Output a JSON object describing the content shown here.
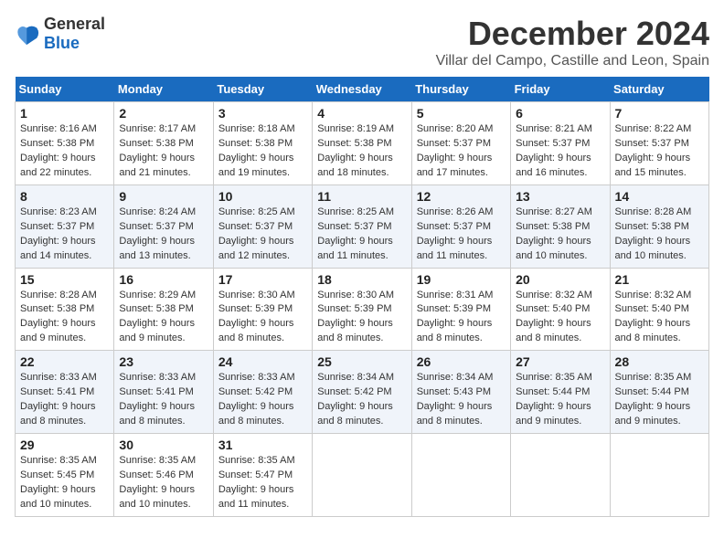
{
  "logo": {
    "text1": "General",
    "text2": "Blue"
  },
  "title": "December 2024",
  "location": "Villar del Campo, Castille and Leon, Spain",
  "days_of_week": [
    "Sunday",
    "Monday",
    "Tuesday",
    "Wednesday",
    "Thursday",
    "Friday",
    "Saturday"
  ],
  "weeks": [
    [
      {
        "day": 1,
        "sunrise": "8:16 AM",
        "sunset": "5:38 PM",
        "daylight": "9 hours and 22 minutes."
      },
      {
        "day": 2,
        "sunrise": "8:17 AM",
        "sunset": "5:38 PM",
        "daylight": "9 hours and 21 minutes."
      },
      {
        "day": 3,
        "sunrise": "8:18 AM",
        "sunset": "5:38 PM",
        "daylight": "9 hours and 19 minutes."
      },
      {
        "day": 4,
        "sunrise": "8:19 AM",
        "sunset": "5:38 PM",
        "daylight": "9 hours and 18 minutes."
      },
      {
        "day": 5,
        "sunrise": "8:20 AM",
        "sunset": "5:37 PM",
        "daylight": "9 hours and 17 minutes."
      },
      {
        "day": 6,
        "sunrise": "8:21 AM",
        "sunset": "5:37 PM",
        "daylight": "9 hours and 16 minutes."
      },
      {
        "day": 7,
        "sunrise": "8:22 AM",
        "sunset": "5:37 PM",
        "daylight": "9 hours and 15 minutes."
      }
    ],
    [
      {
        "day": 8,
        "sunrise": "8:23 AM",
        "sunset": "5:37 PM",
        "daylight": "9 hours and 14 minutes."
      },
      {
        "day": 9,
        "sunrise": "8:24 AM",
        "sunset": "5:37 PM",
        "daylight": "9 hours and 13 minutes."
      },
      {
        "day": 10,
        "sunrise": "8:25 AM",
        "sunset": "5:37 PM",
        "daylight": "9 hours and 12 minutes."
      },
      {
        "day": 11,
        "sunrise": "8:25 AM",
        "sunset": "5:37 PM",
        "daylight": "9 hours and 11 minutes."
      },
      {
        "day": 12,
        "sunrise": "8:26 AM",
        "sunset": "5:37 PM",
        "daylight": "9 hours and 11 minutes."
      },
      {
        "day": 13,
        "sunrise": "8:27 AM",
        "sunset": "5:38 PM",
        "daylight": "9 hours and 10 minutes."
      },
      {
        "day": 14,
        "sunrise": "8:28 AM",
        "sunset": "5:38 PM",
        "daylight": "9 hours and 10 minutes."
      }
    ],
    [
      {
        "day": 15,
        "sunrise": "8:28 AM",
        "sunset": "5:38 PM",
        "daylight": "9 hours and 9 minutes."
      },
      {
        "day": 16,
        "sunrise": "8:29 AM",
        "sunset": "5:38 PM",
        "daylight": "9 hours and 9 minutes."
      },
      {
        "day": 17,
        "sunrise": "8:30 AM",
        "sunset": "5:39 PM",
        "daylight": "9 hours and 8 minutes."
      },
      {
        "day": 18,
        "sunrise": "8:30 AM",
        "sunset": "5:39 PM",
        "daylight": "9 hours and 8 minutes."
      },
      {
        "day": 19,
        "sunrise": "8:31 AM",
        "sunset": "5:39 PM",
        "daylight": "9 hours and 8 minutes."
      },
      {
        "day": 20,
        "sunrise": "8:32 AM",
        "sunset": "5:40 PM",
        "daylight": "9 hours and 8 minutes."
      },
      {
        "day": 21,
        "sunrise": "8:32 AM",
        "sunset": "5:40 PM",
        "daylight": "9 hours and 8 minutes."
      }
    ],
    [
      {
        "day": 22,
        "sunrise": "8:33 AM",
        "sunset": "5:41 PM",
        "daylight": "9 hours and 8 minutes."
      },
      {
        "day": 23,
        "sunrise": "8:33 AM",
        "sunset": "5:41 PM",
        "daylight": "9 hours and 8 minutes."
      },
      {
        "day": 24,
        "sunrise": "8:33 AM",
        "sunset": "5:42 PM",
        "daylight": "9 hours and 8 minutes."
      },
      {
        "day": 25,
        "sunrise": "8:34 AM",
        "sunset": "5:42 PM",
        "daylight": "9 hours and 8 minutes."
      },
      {
        "day": 26,
        "sunrise": "8:34 AM",
        "sunset": "5:43 PM",
        "daylight": "9 hours and 8 minutes."
      },
      {
        "day": 27,
        "sunrise": "8:35 AM",
        "sunset": "5:44 PM",
        "daylight": "9 hours and 9 minutes."
      },
      {
        "day": 28,
        "sunrise": "8:35 AM",
        "sunset": "5:44 PM",
        "daylight": "9 hours and 9 minutes."
      }
    ],
    [
      {
        "day": 29,
        "sunrise": "8:35 AM",
        "sunset": "5:45 PM",
        "daylight": "9 hours and 10 minutes."
      },
      {
        "day": 30,
        "sunrise": "8:35 AM",
        "sunset": "5:46 PM",
        "daylight": "9 hours and 10 minutes."
      },
      {
        "day": 31,
        "sunrise": "8:35 AM",
        "sunset": "5:47 PM",
        "daylight": "9 hours and 11 minutes."
      },
      null,
      null,
      null,
      null
    ]
  ]
}
